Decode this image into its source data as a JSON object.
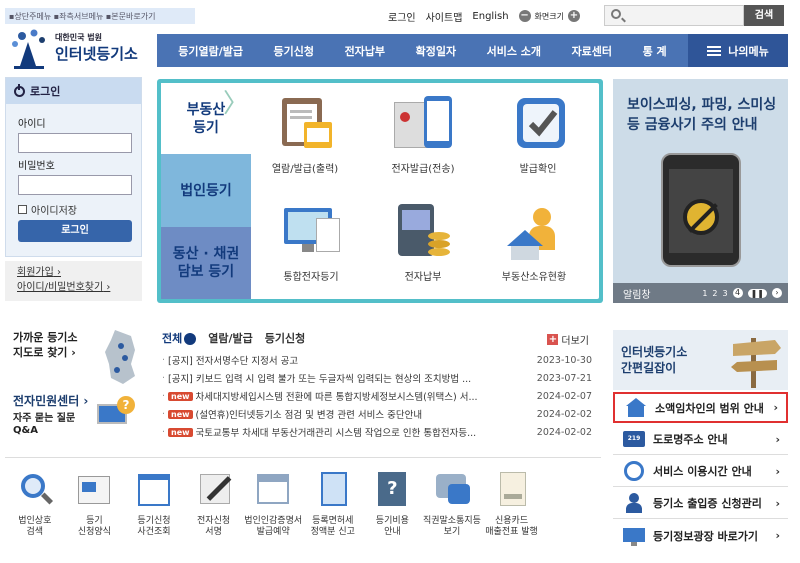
{
  "skip": {
    "text": "▪상단주메뉴 ▪좌측서브메뉴 ▪본문바로가기"
  },
  "toplinks": {
    "login": "로그인",
    "sitemap": "사이트맵",
    "english": "English",
    "screen_size": "화면크기"
  },
  "search": {
    "placeholder": "",
    "button": "검색"
  },
  "logo": {
    "line1": "대한민국 법원",
    "line2": "인터넷등기소"
  },
  "nav": {
    "items": [
      "등기열람/발급",
      "등기신청",
      "전자납부",
      "확정일자",
      "서비스 소개",
      "자료센터",
      "통 계"
    ],
    "my_menu": "나의메뉴"
  },
  "login": {
    "title": "로그인",
    "id_label": "아이디",
    "pw_label": "비밀번호",
    "save_id": "아이디저장",
    "button": "로그인",
    "join": "회원가입",
    "find": "아이디/비밀번호찾기"
  },
  "center": {
    "tabs": [
      "부동산\n등기",
      "법인등기",
      "동산 · 채권\n담보 등기"
    ],
    "services": [
      "열람/발급(출력)",
      "전자발급(전송)",
      "발급확인",
      "통합전자등기",
      "전자납부",
      "부동산소유현황"
    ]
  },
  "banner": {
    "title": "보이스피싱, 파밍, 스미싱\n등 금융사기 주의 안내",
    "footer_label": "알림창",
    "pages": [
      "1",
      "2",
      "3",
      "4"
    ]
  },
  "korea": {
    "title": "가까운 등기소\n지도로 찾기 ›"
  },
  "civil": {
    "title": "전자민원센터 ›",
    "faq": "자주 묻는 질문\nQ&A"
  },
  "news": {
    "tabs": [
      "전체",
      "열람/발급",
      "등기신청"
    ],
    "more": "더보기",
    "new_label": "new",
    "items": [
      {
        "tag": "",
        "title": "[공지] 전자서명수단 지정서 공고",
        "date": "2023-10-30"
      },
      {
        "tag": "",
        "title": "[공지] 키보드 입력 시 입력 불가 또는 두글자씩 입력되는 현상의 조치방법 ...",
        "date": "2023-07-21"
      },
      {
        "tag": "new",
        "title": "차세대지방세입시스템 전환에 따른 통합지방세정보시스템(위택스) 서...",
        "date": "2024-02-07"
      },
      {
        "tag": "new",
        "title": "(설연휴)인터넷등기소 점검 및 변경 관련 서비스 중단안내",
        "date": "2024-02-02"
      },
      {
        "tag": "new",
        "title": "국토교통부 차세대 부동산거래관리 시스템 작업으로 인한 통합전자등...",
        "date": "2024-02-02"
      }
    ]
  },
  "guide": {
    "title": "인터넷등기소\n간편길잡이",
    "items": [
      "소액임차인의 범위 안내",
      "도로명주소 안내",
      "서비스 이용시간 안내",
      "등기소 출입증 신청관리",
      "등기정보광장 바로가기"
    ]
  },
  "quick": [
    "법인상호\n검색",
    "등기\n신청양식",
    "등기신청\n사건조회",
    "전자신청\n서명",
    "법인인감증명서\n발급예약",
    "등록면허세\n정액분 신고",
    "등기비용\n안내",
    "직권말소통지등\n보기",
    "신용카드\n매출전표 발행"
  ],
  "colors": {
    "nav": "#4a73b4",
    "teal": "#53bfc9",
    "tab_blue": "#7fb7dc",
    "tab_green": "#8fc7c0",
    "tab_purple": "#6e8cc4",
    "highlight": "#e03030"
  }
}
